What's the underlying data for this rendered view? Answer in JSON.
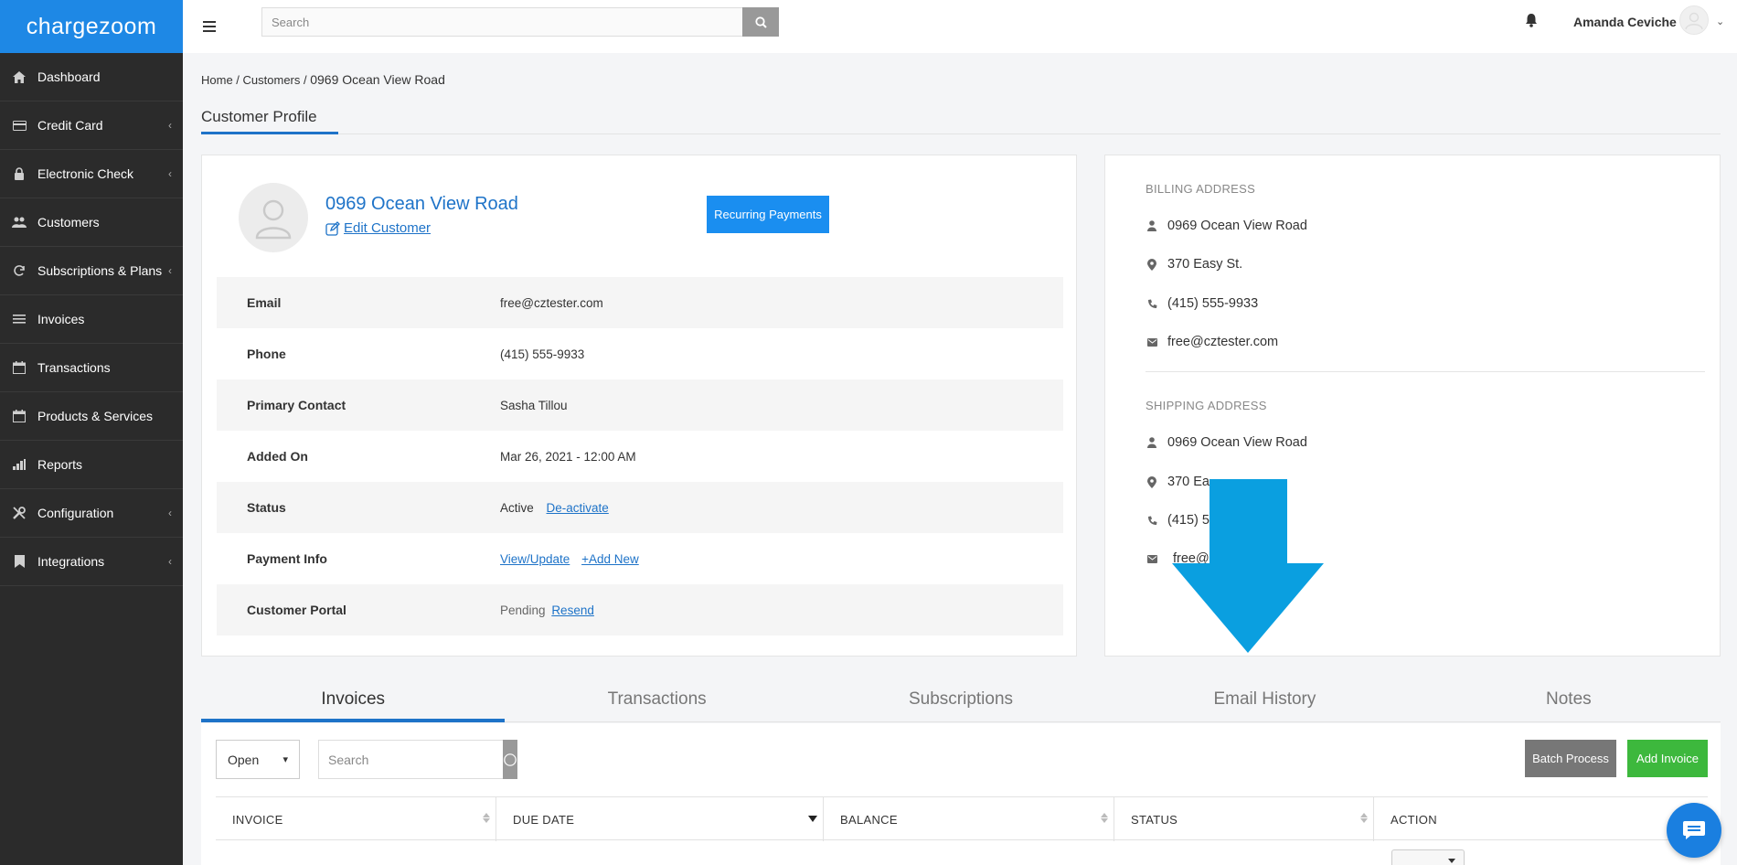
{
  "brand": {
    "name": "chargezoom"
  },
  "sidebar": {
    "items": [
      {
        "label": "Dashboard",
        "icon": "home-icon",
        "has_submenu": false
      },
      {
        "label": "Credit Card",
        "icon": "credit-card-icon",
        "has_submenu": true
      },
      {
        "label": "Electronic Check",
        "icon": "lock-icon",
        "has_submenu": true
      },
      {
        "label": "Customers",
        "icon": "users-icon",
        "has_submenu": false
      },
      {
        "label": "Subscriptions & Plans",
        "icon": "refresh-icon",
        "has_submenu": true
      },
      {
        "label": "Invoices",
        "icon": "list-icon",
        "has_submenu": false
      },
      {
        "label": "Transactions",
        "icon": "calendar-icon",
        "has_submenu": false
      },
      {
        "label": "Products & Services",
        "icon": "calendar-icon",
        "has_submenu": false
      },
      {
        "label": "Reports",
        "icon": "bar-chart-icon",
        "has_submenu": false
      },
      {
        "label": "Configuration",
        "icon": "tools-icon",
        "has_submenu": true
      },
      {
        "label": "Integrations",
        "icon": "bookmark-icon",
        "has_submenu": true
      }
    ]
  },
  "topbar": {
    "search_placeholder": "Search",
    "user_name": "Amanda Ceviche"
  },
  "breadcrumb": {
    "home": "Home",
    "customers": "Customers",
    "current": "0969 Ocean View Road",
    "sep": " / "
  },
  "page": {
    "title": "Customer Profile"
  },
  "profile": {
    "name": "0969 Ocean View Road",
    "edit_label": "Edit Customer",
    "recurring_label": "Recurring Payments",
    "rows": {
      "email": {
        "label": "Email",
        "value": "free@cztester.com"
      },
      "phone": {
        "label": "Phone",
        "value": "(415) 555-9933"
      },
      "primary_contact": {
        "label": "Primary Contact",
        "value": "Sasha Tillou"
      },
      "added_on": {
        "label": "Added On",
        "value": "Mar 26, 2021 - 12:00 AM"
      },
      "status": {
        "label": "Status",
        "value": "Active",
        "action": "De-activate"
      },
      "payment_info": {
        "label": "Payment Info",
        "view": "View/Update",
        "add": "+Add New"
      },
      "customer_portal": {
        "label": "Customer Portal",
        "value": "Pending",
        "action": "Resend"
      }
    }
  },
  "billing": {
    "heading": "BILLING ADDRESS",
    "name": "0969 Ocean View Road",
    "street": "370 Easy St.",
    "phone": "(415) 555-9933",
    "email": "free@cztester.com"
  },
  "shipping": {
    "heading": "SHIPPING ADDRESS",
    "name": "0969 Ocean View Road",
    "street": "370 Ea",
    "phone": "(415) 5",
    "email": "free@"
  },
  "tabs": [
    {
      "label": "Invoices",
      "active": true
    },
    {
      "label": "Transactions",
      "active": false
    },
    {
      "label": "Subscriptions",
      "active": false
    },
    {
      "label": "Email History",
      "active": false
    },
    {
      "label": "Notes",
      "active": false
    }
  ],
  "invoices_panel": {
    "filter_selected": "Open",
    "search_placeholder": "Search",
    "batch_label": "Batch Process",
    "add_label": "Add Invoice",
    "columns": [
      "INVOICE",
      "DUE DATE",
      "BALANCE",
      "STATUS",
      "ACTION"
    ]
  },
  "colors": {
    "brand_blue": "#1e88e5",
    "link_blue": "#1e73c8",
    "sidebar_bg": "#2b2b2b",
    "success_green": "#3db83d",
    "arrow_blue": "#0a9fe0"
  }
}
